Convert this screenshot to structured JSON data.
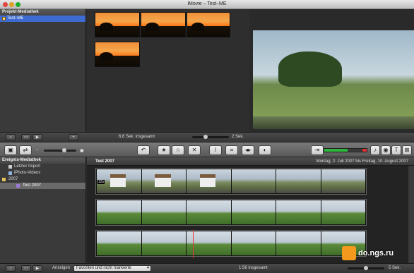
{
  "window": {
    "title": "iMovie – Test–ME"
  },
  "project_library": {
    "header": "Projekt-Mediathek",
    "items": [
      {
        "label": "Test–ME"
      }
    ]
  },
  "project_bar": {
    "total": "6,6 Sek. insgesamt",
    "zoom_label": "2 Sek.",
    "zoom_level": 0.35
  },
  "toolbar": {
    "icons": [
      "camera-import-icon",
      "swap-icon",
      "thumb-small-icon",
      "thumb-large-icon",
      "undo-icon",
      "star-icon",
      "star-outline-icon",
      "reject-icon",
      "wand-icon",
      "crop-icon",
      "audio-icon",
      "color-icon",
      "audio-meter-icon",
      "music-icon",
      "photo-icon",
      "title-icon",
      "transition-icon"
    ],
    "thumb_size_level": 0.65
  },
  "event_library": {
    "header": "Ereignis-Mediathek",
    "items": [
      {
        "label": "Letzter Import"
      },
      {
        "label": "iPhoto-Videos"
      },
      {
        "label": "2007"
      },
      {
        "label": "Test 2007"
      }
    ]
  },
  "event_browser": {
    "title": "Test 2007",
    "date_range": "Montag, 2. Juli 2007 bis Freitag, 10. August 2007",
    "first_clip_label": "12s"
  },
  "bottom_bar": {
    "show_label": "Anzeigen",
    "filter_value": "Favoriten und nicht markierte",
    "total": "1:56 insgesamt",
    "zoom_label": "5 Sek."
  },
  "watermark": {
    "text": "do.ngs.ru"
  }
}
